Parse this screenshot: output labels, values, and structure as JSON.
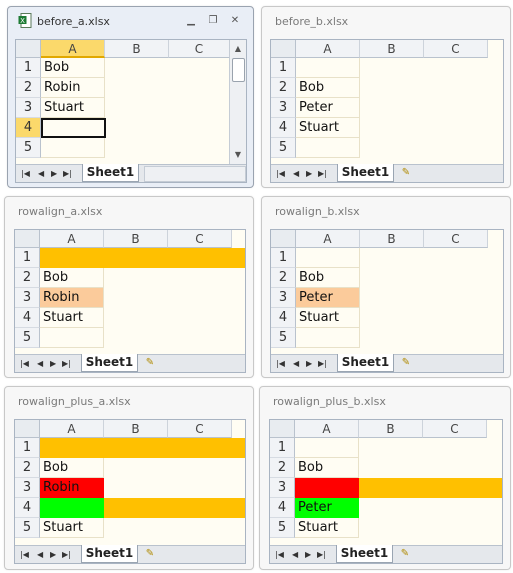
{
  "colors": {
    "orange": "#ffc000",
    "peach": "#fbcb9b",
    "red": "#ff0000",
    "green": "#00ff00"
  },
  "windows": [
    {
      "title": "before_a.xlsx",
      "tab": "Sheet1",
      "columns": [
        "A",
        "B",
        "C"
      ],
      "rows": [
        "1",
        "2",
        "3",
        "4",
        "5"
      ],
      "cells": [
        [
          "Bob",
          "",
          ""
        ],
        [
          "Robin",
          "",
          ""
        ],
        [
          "Stuart",
          "",
          ""
        ],
        [
          "",
          "",
          ""
        ],
        [
          "",
          "",
          ""
        ]
      ]
    },
    {
      "title": "before_b.xlsx",
      "tab": "Sheet1",
      "columns": [
        "A",
        "B",
        "C"
      ],
      "rows": [
        "1",
        "2",
        "3",
        "4",
        "5"
      ],
      "cells": [
        [
          "",
          "",
          ""
        ],
        [
          "Bob",
          "",
          ""
        ],
        [
          "Peter",
          "",
          ""
        ],
        [
          "Stuart",
          "",
          ""
        ],
        [
          "",
          "",
          ""
        ]
      ]
    },
    {
      "title": "rowalign_a.xlsx",
      "tab": "Sheet1",
      "columns": [
        "A",
        "B",
        "C"
      ],
      "rows": [
        "1",
        "2",
        "3",
        "4",
        "5"
      ],
      "cells": [
        [
          "",
          "",
          ""
        ],
        [
          "Bob",
          "",
          ""
        ],
        [
          "Robin",
          "",
          ""
        ],
        [
          "Stuart",
          "",
          ""
        ],
        [
          "",
          "",
          ""
        ]
      ]
    },
    {
      "title": "rowalign_b.xlsx",
      "tab": "Sheet1",
      "columns": [
        "A",
        "B",
        "C"
      ],
      "rows": [
        "1",
        "2",
        "3",
        "4",
        "5"
      ],
      "cells": [
        [
          "",
          "",
          ""
        ],
        [
          "Bob",
          "",
          ""
        ],
        [
          "Peter",
          "",
          ""
        ],
        [
          "Stuart",
          "",
          ""
        ],
        [
          "",
          "",
          ""
        ]
      ]
    },
    {
      "title": "rowalign_plus_a.xlsx",
      "tab": "Sheet1",
      "columns": [
        "A",
        "B",
        "C"
      ],
      "rows": [
        "1",
        "2",
        "3",
        "4",
        "5"
      ],
      "cells": [
        [
          "",
          "",
          ""
        ],
        [
          "Bob",
          "",
          ""
        ],
        [
          "Robin",
          "",
          ""
        ],
        [
          "",
          "",
          ""
        ],
        [
          "Stuart",
          "",
          ""
        ]
      ]
    },
    {
      "title": "rowalign_plus_b.xlsx",
      "tab": "Sheet1",
      "columns": [
        "A",
        "B",
        "C"
      ],
      "rows": [
        "1",
        "2",
        "3",
        "4",
        "5"
      ],
      "cells": [
        [
          "",
          "",
          ""
        ],
        [
          "Bob",
          "",
          ""
        ],
        [
          "",
          "",
          ""
        ],
        [
          "Peter",
          "",
          ""
        ],
        [
          "Stuart",
          "",
          ""
        ]
      ]
    }
  ]
}
